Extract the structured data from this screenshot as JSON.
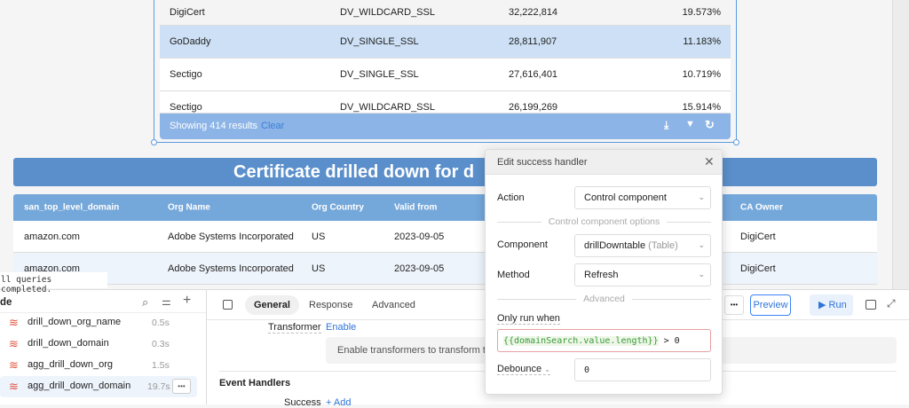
{
  "top_table": {
    "rows": [
      {
        "ca": "DigiCert",
        "type": "DV_WILDCARD_SSL",
        "count": "32,222,814",
        "pct": "19.573%"
      },
      {
        "ca": "GoDaddy",
        "type": "DV_SINGLE_SSL",
        "count": "28,811,907",
        "pct": "11.183%"
      },
      {
        "ca": "Sectigo",
        "type": "DV_SINGLE_SSL",
        "count": "27,616,401",
        "pct": "10.719%"
      },
      {
        "ca": "Sectigo",
        "type": "DV_WILDCARD_SSL",
        "count": "26,199,269",
        "pct": "15.914%"
      }
    ],
    "footer": {
      "showing": "Showing 414 results",
      "clear": "Clear"
    }
  },
  "banner": {
    "title": "Certificate drilled down for d"
  },
  "drill_table": {
    "headers": {
      "domain": "san_top_level_domain",
      "org": "Org Name",
      "country": "Org Country",
      "valid": "Valid from",
      "owner": "CA Owner"
    },
    "rows": [
      {
        "domain": "amazon.com",
        "org": "Adobe Systems Incorporated",
        "country": "US",
        "valid": "2023-09-05",
        "owner": "DigiCert"
      },
      {
        "domain": "amazon.com",
        "org": "Adobe Systems Incorporated",
        "country": "US",
        "valid": "2023-09-05",
        "owner": "DigiCert"
      }
    ]
  },
  "toast": "ll queries completed.",
  "query_panel": {
    "title": "de",
    "queries": [
      {
        "name": "drill_down_org_name",
        "time": "0.5s"
      },
      {
        "name": "drill_down_domain",
        "time": "0.3s"
      },
      {
        "name": "agg_drill_down_org",
        "time": "1.5s"
      },
      {
        "name": "agg_drill_down_domain",
        "time": "19.7s"
      }
    ]
  },
  "editor": {
    "tabs": [
      "General",
      "Response",
      "Advanced"
    ],
    "preview": "Preview",
    "run": "Run",
    "more": "•••",
    "transformer_label": "Transformer",
    "transformer_enable": "Enable",
    "transformer_hint": "Enable transformers to transform th",
    "event_handlers": "Event Handlers",
    "success_label": "Success",
    "add": "+ Add"
  },
  "modal": {
    "title": "Edit success handler",
    "action_label": "Action",
    "action_value": "Control component",
    "options_divider": "Control component options",
    "component_label": "Component",
    "component_value": "drillDowntable",
    "component_type": "(Table)",
    "method_label": "Method",
    "method_value": "Refresh",
    "advanced_divider": "Advanced",
    "only_run_label": "Only run when",
    "only_run_expr": "{{domainSearch.value.length}}",
    "only_run_rest": " > 0",
    "debounce_label": "Debounce",
    "debounce_value": "0"
  },
  "colors": {
    "accent": "#3b82f6",
    "banner": "#5b8fcb",
    "header": "#74a7da",
    "selected_row": "#cde0f5"
  }
}
